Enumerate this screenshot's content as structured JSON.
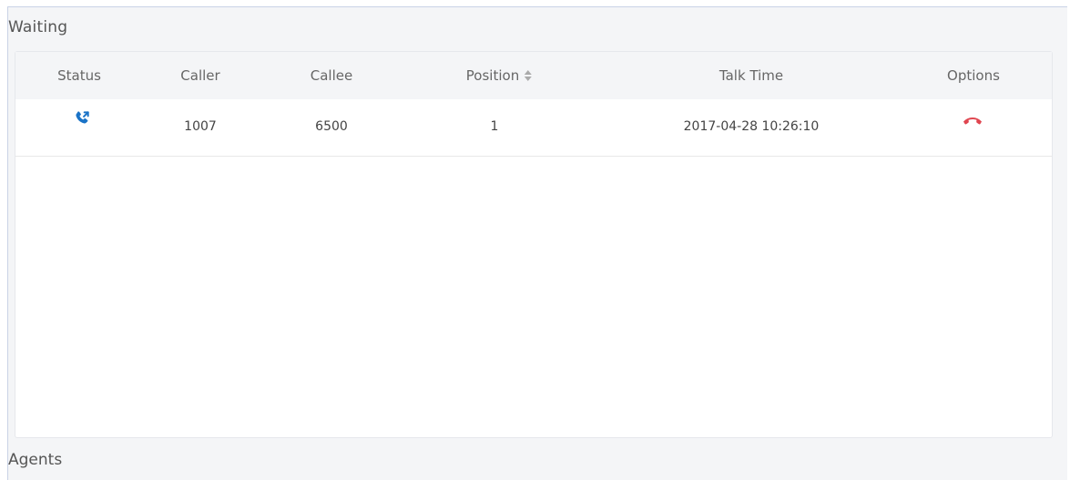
{
  "sections": {
    "waiting_title": "Waiting",
    "agents_title": "Agents"
  },
  "table": {
    "headers": {
      "status": "Status",
      "caller": "Caller",
      "callee": "Callee",
      "position": "Position",
      "talk_time": "Talk Time",
      "options": "Options"
    },
    "rows": [
      {
        "status_icon": "incoming-call-icon",
        "caller": "1007",
        "callee": "6500",
        "position": "1",
        "talk_time": "2017-04-28 10:26:10",
        "option_icon": "hang-up-icon"
      }
    ]
  },
  "colors": {
    "status_icon": "#1a73c7",
    "hangup_icon": "#e0454f",
    "panel_bg": "#f4f5f7"
  }
}
